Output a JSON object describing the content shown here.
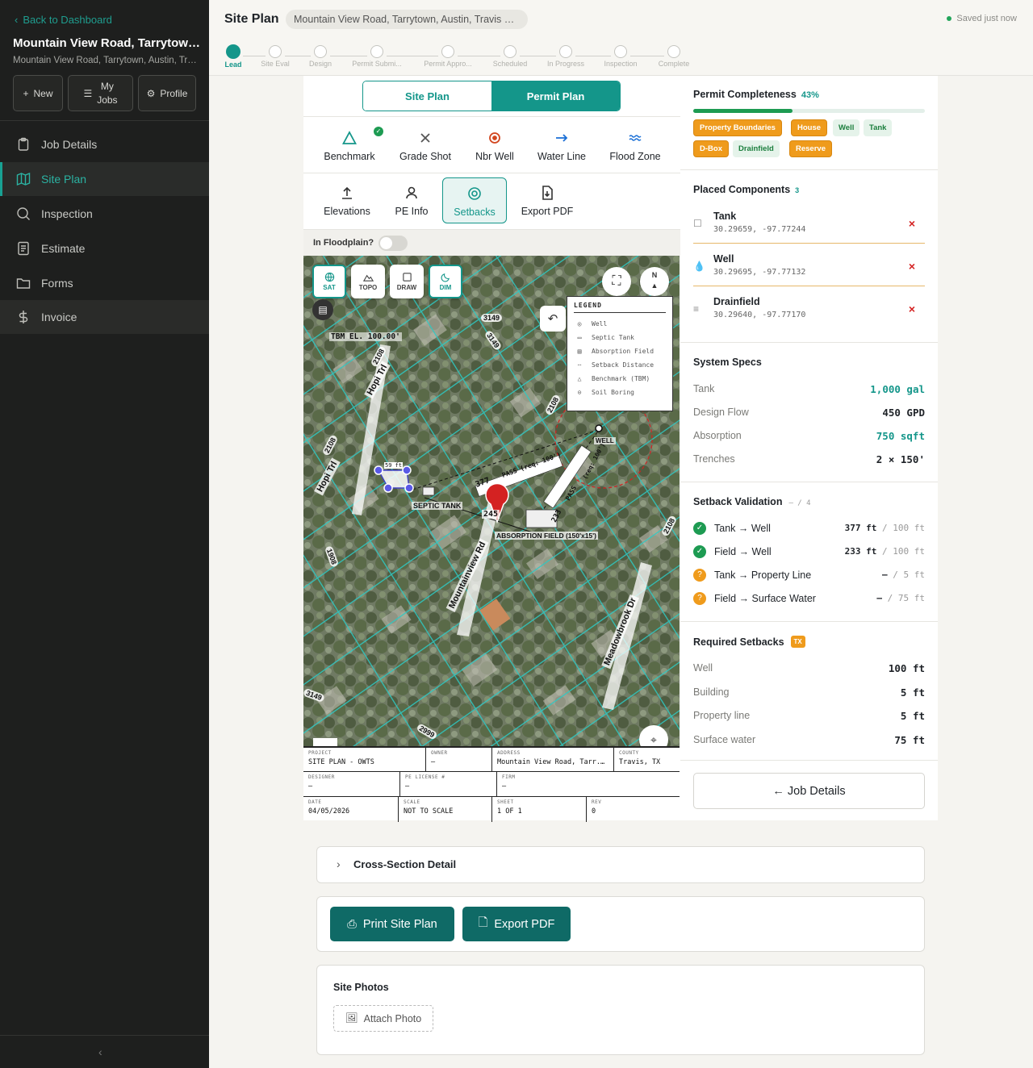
{
  "sidebar": {
    "back_label": "Back to Dashboard",
    "job_title": "Mountain View Road, Tarrytown...",
    "job_subtitle": "Mountain View Road, Tarrytown, Austin, Tra...",
    "buttons": {
      "new": "New",
      "my_jobs_1": "My",
      "my_jobs_2": "Jobs",
      "profile": "Profile"
    },
    "nav": [
      {
        "label": "Job Details",
        "icon": "clipboard-icon"
      },
      {
        "label": "Site Plan",
        "icon": "map-icon",
        "active": true
      },
      {
        "label": "Inspection",
        "icon": "search-icon"
      },
      {
        "label": "Estimate",
        "icon": "document-icon"
      },
      {
        "label": "Forms",
        "icon": "folder-icon"
      },
      {
        "label": "Invoice",
        "icon": "dollar-icon"
      }
    ],
    "collapse": "‹"
  },
  "header": {
    "title": "Site Plan",
    "address": "Mountain View Road, Tarrytown, Austin, Travis Co...",
    "saved": "Saved just now"
  },
  "stepper": [
    "Lead",
    "Site Eval",
    "Design",
    "Permit Submi...",
    "Permit Appro...",
    "Scheduled",
    "In Progress",
    "Inspection",
    "Complete"
  ],
  "plan_toggle": {
    "site_plan": "Site Plan",
    "permit_plan": "Permit Plan",
    "selected": "Permit Plan"
  },
  "tools_row1": [
    {
      "label": "Benchmark",
      "icon": "triangle-icon"
    },
    {
      "label": "Grade Shot",
      "icon": "x-icon"
    },
    {
      "label": "Nbr Well",
      "icon": "target-icon"
    },
    {
      "label": "Water Line",
      "icon": "arrow-right-icon"
    },
    {
      "label": "Flood Zone",
      "icon": "waves-icon"
    }
  ],
  "tools_row2": [
    {
      "label": "Elevations",
      "icon": "upload-icon"
    },
    {
      "label": "PE Info",
      "icon": "person-icon"
    },
    {
      "label": "Setbacks",
      "icon": "target-icon",
      "selected": true
    },
    {
      "label": "Export PDF",
      "icon": "file-download-icon"
    }
  ],
  "floodplain": {
    "label": "In Floodplain?",
    "on": false
  },
  "map": {
    "buttons": {
      "sat": "SAT",
      "topo": "TOPO",
      "draw": "DRAW",
      "dim": "DIM"
    },
    "active_layer": "SAT",
    "labels": {
      "tbm": "TBM EL. 100.00'",
      "road_mountainview": "Mountainview Rd",
      "road_hopi": "Hopi Trl",
      "road_meadowbrook": "Meadowbrook Dr",
      "septic_tank": "SEPTIC TANK",
      "absorption_field": "ABSORPTION FIELD (150'x15')",
      "well": "WELL",
      "dim_59": "59 ft",
      "dist_377": "377",
      "dist_245": "245",
      "dist_233": "233",
      "pass_req_100": "PASS (req: 100')",
      "pass": "PASS",
      "req_100": "(req: 100')",
      "n": "N",
      "parcel_nums": [
        "3149",
        "2108",
        "2108",
        "2108",
        "2108",
        "3149",
        "2999",
        "1908",
        "3149"
      ]
    },
    "legend": {
      "title": "LEGEND",
      "items": [
        "Well",
        "Septic Tank",
        "Absorption Field",
        "Setback Distance",
        "Benchmark (TBM)",
        "Soil Boring"
      ]
    }
  },
  "title_block": {
    "project_k": "PROJECT",
    "project_v": "SITE PLAN - OWTS",
    "owner_k": "OWNER",
    "owner_v": "—",
    "address_k": "ADDRESS",
    "address_v": "Mountain View Road, Tarr...",
    "county_k": "COUNTY",
    "county_v": "Travis, TX",
    "designer_k": "DESIGNER",
    "designer_v": "—",
    "pe_k": "PE LICENSE #",
    "pe_v": "—",
    "firm_k": "FIRM",
    "firm_v": "—",
    "date_k": "DATE",
    "date_v": "04/05/2026",
    "scale_k": "SCALE",
    "scale_v": "NOT TO SCALE",
    "sheet_k": "SHEET",
    "sheet_v": "1 OF 1",
    "rev_k": "REV",
    "rev_v": "0"
  },
  "completeness": {
    "title": "Permit Completeness",
    "percent_label": "43%",
    "percent": 0.43,
    "chips": [
      {
        "label": "Property Boundaries",
        "state": "missing"
      },
      {
        "label": "House",
        "state": "missing"
      },
      {
        "label": "Well",
        "state": "done"
      },
      {
        "label": "Tank",
        "state": "done"
      },
      {
        "label": "D-Box",
        "state": "missing"
      },
      {
        "label": "Drainfield",
        "state": "done"
      },
      {
        "label": "Reserve",
        "state": "missing"
      }
    ]
  },
  "placed": {
    "title": "Placed Components",
    "count": "3",
    "items": [
      {
        "name": "Tank",
        "coords": "30.29659, -97.77244",
        "icon": "square-icon"
      },
      {
        "name": "Well",
        "coords": "30.29695, -97.77132",
        "icon": "droplet-icon"
      },
      {
        "name": "Drainfield",
        "coords": "30.29640, -97.77170",
        "icon": "lines-icon"
      }
    ],
    "remove": "×"
  },
  "specs": {
    "title": "System Specs",
    "rows": [
      {
        "k": "Tank",
        "v": "1,000 gal",
        "accent": true
      },
      {
        "k": "Design Flow",
        "v": "450 GPD",
        "accent": false
      },
      {
        "k": "Absorption",
        "v": "750 sqft",
        "accent": true
      },
      {
        "k": "Trenches",
        "v": "2 × 150'",
        "accent": false
      }
    ]
  },
  "validation": {
    "title": "Setback Validation",
    "count": "— / 4",
    "rows": [
      {
        "label": "Tank → Well",
        "value": "377 ft",
        "req": " / 100 ft",
        "ok": true
      },
      {
        "label": "Field → Well",
        "value": "233 ft",
        "req": " / 100 ft",
        "ok": true
      },
      {
        "label": "Tank → Property Line",
        "value": "—",
        "req": " / 5 ft",
        "ok": false
      },
      {
        "label": "Field → Surface Water",
        "value": "—",
        "req": " / 75 ft",
        "ok": false
      }
    ],
    "ok_glyph": "✓",
    "warn_glyph": "?"
  },
  "required": {
    "title": "Required Setbacks",
    "badge": "TX",
    "rows": [
      {
        "k": "Well",
        "v": "100 ft"
      },
      {
        "k": "Building",
        "v": "5 ft"
      },
      {
        "k": "Property line",
        "v": "5 ft"
      },
      {
        "k": "Surface water",
        "v": "75 ft"
      }
    ]
  },
  "job_details_btn": "← Job Details",
  "cross_section": "Cross-Section Detail",
  "print_btn": "Print Site Plan",
  "export_btn": "Export PDF",
  "photos": {
    "title": "Site Photos",
    "attach": "Attach Photo"
  },
  "colors": {
    "accent": "#14968a",
    "success": "#1d9b52",
    "warning": "#ef9b1c",
    "danger": "#d42222",
    "sidebar": "#1e1f1e"
  }
}
